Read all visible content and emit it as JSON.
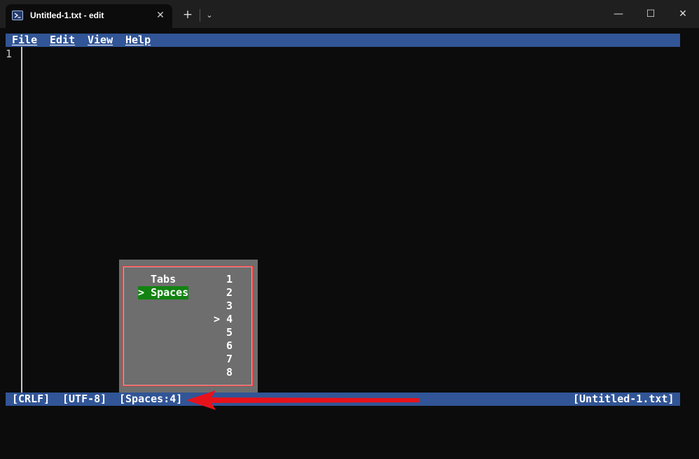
{
  "window": {
    "tab_title": "Untitled-1.txt - edit",
    "tab_close_glyph": "✕",
    "new_tab_glyph": "+",
    "dropdown_glyph": "⌄",
    "minimize_glyph": "—",
    "maximize_glyph": "☐",
    "close_glyph": "✕"
  },
  "menu": {
    "items": [
      "File",
      "Edit",
      "View",
      "Help"
    ]
  },
  "editor": {
    "line_numbers": [
      "1"
    ]
  },
  "indent_popup": {
    "mode_options": [
      {
        "label": "Tabs",
        "selected": false
      },
      {
        "label": "Spaces",
        "selected": true
      }
    ],
    "selected_marker": ">",
    "width_options": [
      {
        "label": "1",
        "selected": false
      },
      {
        "label": "2",
        "selected": false
      },
      {
        "label": "3",
        "selected": false
      },
      {
        "label": "4",
        "selected": true
      },
      {
        "label": "5",
        "selected": false
      },
      {
        "label": "6",
        "selected": false
      },
      {
        "label": "7",
        "selected": false
      },
      {
        "label": "8",
        "selected": false
      }
    ]
  },
  "status": {
    "line_ending": "[CRLF]",
    "encoding": "[UTF-8]",
    "indentation": "[Spaces:4]",
    "filename": "[Untitled-1.txt]"
  },
  "colors": {
    "bar_blue": "#315596",
    "popup_gray": "#6e6e6e",
    "selection_green": "#128312",
    "highlight_red": "#ff3b3b",
    "arrow_red": "#e8121b"
  }
}
